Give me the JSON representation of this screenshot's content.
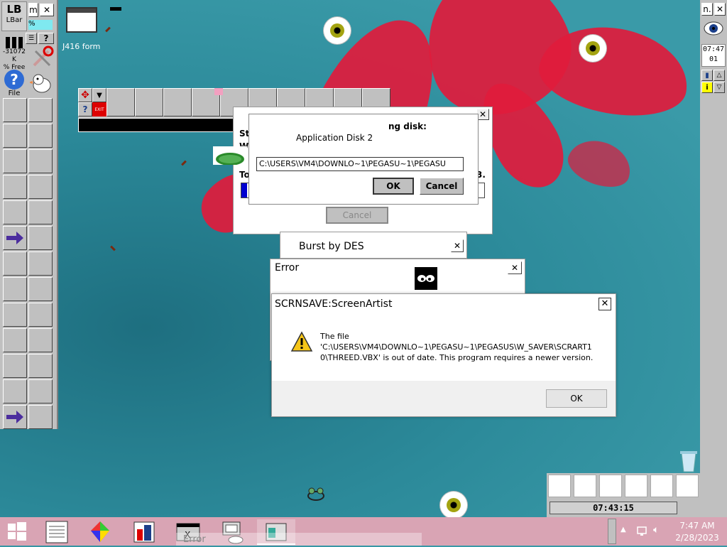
{
  "desktop": {
    "icon_label": "J416 form",
    "time_widget": "07:43:15"
  },
  "left_toolbar": {
    "tab_label": "m",
    "lbar_logo": "LB",
    "lbar_label": "LBar",
    "percent_label": "%",
    "help_label": "?",
    "memory_value": "-31072 K",
    "memory_label": "% Free",
    "file_label": "File"
  },
  "right_toolbar": {
    "tab_label": "n.",
    "clock_line1": "07:47",
    "clock_line2": "01"
  },
  "floating_toolbar": {
    "exit_label": "EXIT"
  },
  "insert_disk_dialog": {
    "partial_title": "ng disk:",
    "disk_name": "Application Disk 2",
    "path_value": "C:\\USERS\\VM4\\DOWNLO~1\\PEGASU~1\\PEGASU",
    "ok_label": "OK",
    "cancel_label": "Cancel"
  },
  "setup_dialog": {
    "frag_st": "St",
    "frag_w": "W",
    "frag_to": "To",
    "frag_3": "3.",
    "cancel_label": "Cancel"
  },
  "burst_window": {
    "title": "Burst by DES"
  },
  "error_window": {
    "title": "Error"
  },
  "screenartist_dialog": {
    "title": "SCRNSAVE:ScreenArtist",
    "message_line1": "The file",
    "message_line2": "'C:\\USERS\\VM4\\DOWNLO~1\\PEGASU~1\\PEGASUS\\W_SAVER\\SCRART1",
    "message_line3": "0\\THREED.VBX' is out of date.  This program requires a newer version.",
    "ok_label": "OK"
  },
  "taskbar": {
    "ghost_label": "Error",
    "clock_time": "7:47 AM",
    "clock_date": "2/28/2023"
  }
}
